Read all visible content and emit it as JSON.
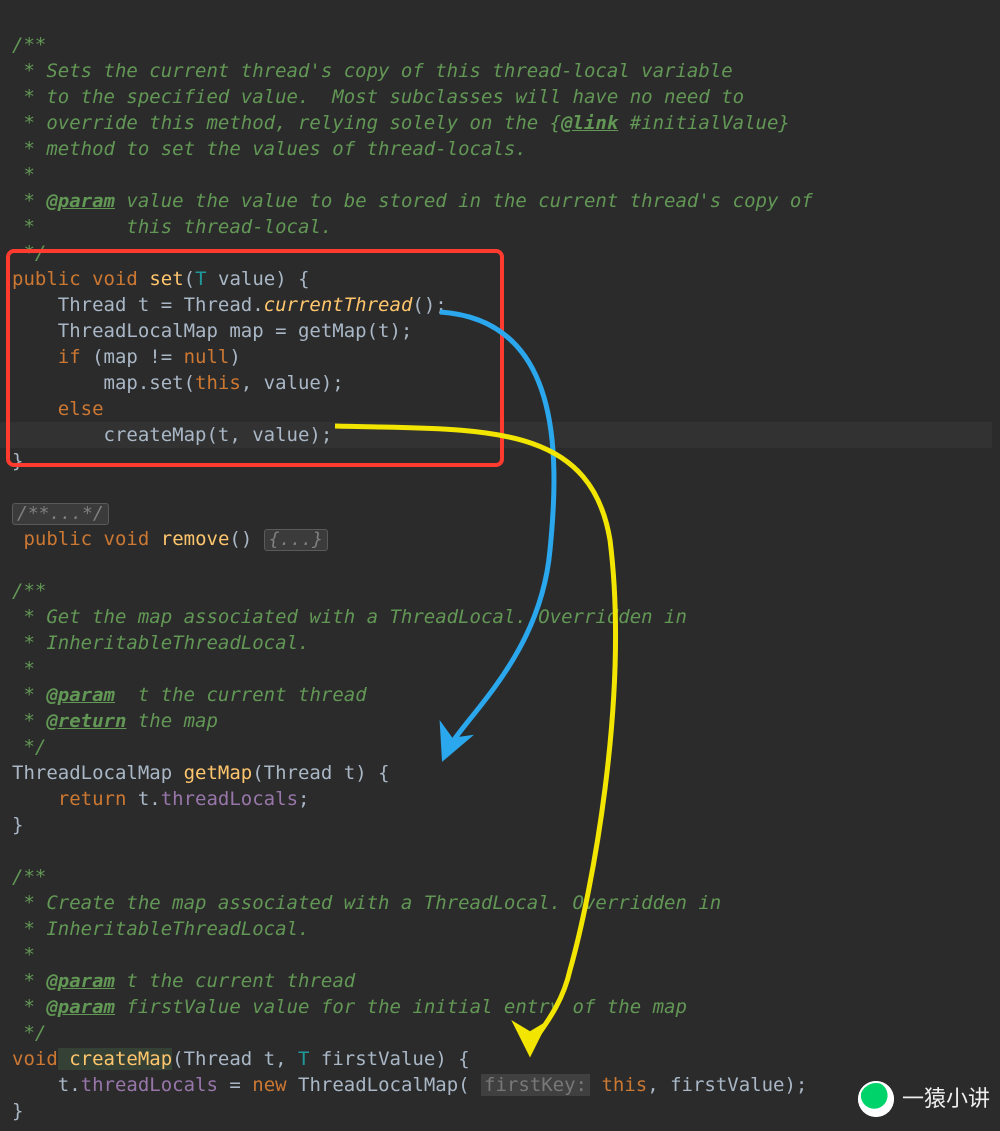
{
  "comment1": {
    "l1": "/**",
    "l2": " * Sets the current thread's copy of this thread-local variable",
    "l3": " * to the specified value.  Most subclasses will have no need to",
    "l4a": " * override this method, relying solely on the {",
    "l4tag": "@link",
    "l4b": " #initialValue}",
    "l5": " * method to set the values of thread-locals.",
    "l6": " *",
    "l7a": " * ",
    "l7tag": "@param",
    "l7b": " value",
    "l7c": " the value to be stored in the current thread's copy of",
    "l8": " *        this thread-local.",
    "l9": " */"
  },
  "set": {
    "kw_public": "public",
    "kw_void": "void",
    "fn": "set",
    "type_T": "T",
    "p_value": "value",
    "brace_o": ") {",
    "l2a": "    Thread t = Thread.",
    "l2b": "currentThread",
    "l2c": "();",
    "l3a": "    ThreadLocalMap map = getMap(t);",
    "kw_if": "if",
    "l4a": " (map != ",
    "kw_null": "null",
    "l4b": ")",
    "l5a": "        map.set(",
    "kw_this": "this",
    "l5b": ", value);",
    "kw_else": "else",
    "l7a": "        createMap(t, value);",
    "brace_c": "}"
  },
  "fold1": "/**...*/",
  "remove": {
    "kw_public": " public",
    "kw_void": "void",
    "fn": "remove",
    "paren": "() ",
    "fold": "{...}"
  },
  "comment2": {
    "l1": "/**",
    "l2": " * Get the map associated with a ThreadLocal. Overridden in",
    "l3": " * InheritableThreadLocal.",
    "l4": " *",
    "l5a": " * ",
    "l5tag": "@param",
    "l5b": "  t",
    "l5c": " the current thread",
    "l6a": " * ",
    "l6tag": "@return",
    "l6b": " the map",
    "l7": " */"
  },
  "getmap": {
    "l1a": "ThreadLocalMap ",
    "fn": "getMap",
    "l1b": "(Thread ",
    "p_t": "t",
    "l1c": ") {",
    "kw_return": "return",
    "l2a": " t.",
    "field": "threadLocals",
    "l2b": ";",
    "brace_c": "}"
  },
  "comment3": {
    "l1": "/**",
    "l2": " * Create the map associated with a ThreadLocal. Overridden in",
    "l3": " * InheritableThreadLocal.",
    "l4": " *",
    "l5a": " * ",
    "l5tag": "@param",
    "l5b": " t",
    "l5c": " the current thread",
    "l6a": " * ",
    "l6tag": "@param",
    "l6b": " firstValue",
    "l6c": " value for the initial entry of the map",
    "l7": " */"
  },
  "createmap": {
    "kw_void": "void",
    "fn": " createMap",
    "l1a": "(Thread ",
    "p_t": "t",
    "l1b": ", ",
    "type_T": "T",
    "p_fv": " firstValue",
    "l1c": ") {",
    "l2a": "    t.",
    "field": "threadLocals",
    "l2b": " = ",
    "kw_new": "new",
    "l2c": " ThreadLocalMap( ",
    "hint": "firstKey:",
    "kw_this": "this",
    "l2d": ", firstValue);",
    "brace_c": "}"
  },
  "badge": "一猿小讲"
}
